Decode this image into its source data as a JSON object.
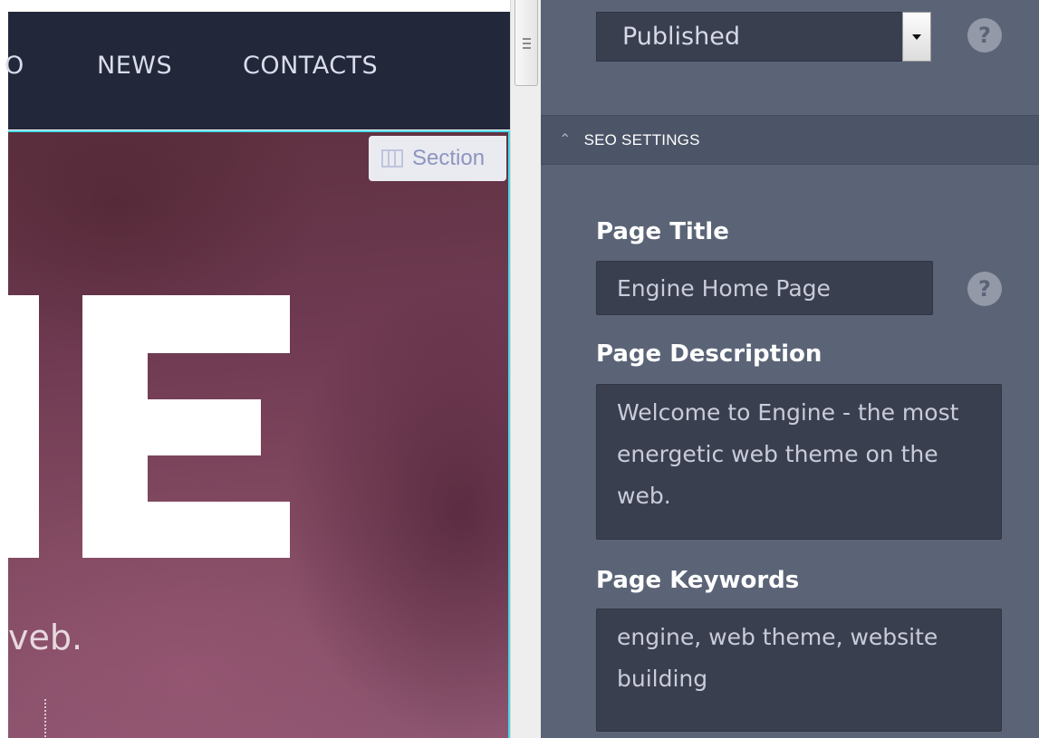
{
  "preview": {
    "nav_items": [
      "O",
      "NEWS",
      "CONTACTS"
    ],
    "section_badge": "Section",
    "hero_subtext": "veb."
  },
  "panel": {
    "status_value": "Published",
    "help_glyph": "?",
    "seo_header": "SEO SETTINGS",
    "page_title": {
      "label": "Page Title",
      "value": "Engine Home Page"
    },
    "page_description": {
      "label": "Page Description",
      "value": "Welcome to Engine - the most energetic web theme on the web."
    },
    "page_keywords": {
      "label": "Page Keywords",
      "value": "engine, web theme, website building"
    }
  },
  "colors": {
    "nav_bg": "#23273a",
    "panel_bg": "#5b6477",
    "field_bg": "#3a3f50",
    "accent_outline": "#46d8e6",
    "hero_bg": "#7a4258"
  },
  "icons": [
    "section-grid-icon",
    "help-icon",
    "chevron-double-up-icon",
    "dropdown-arrow-icon",
    "scroll-grip-icon"
  ]
}
